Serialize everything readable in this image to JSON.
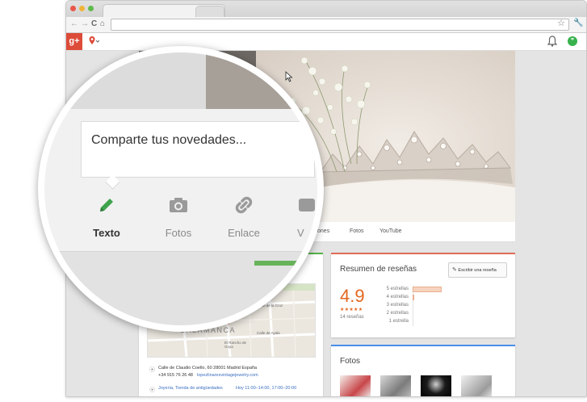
{
  "browser": {
    "buttons": {
      "back": "←",
      "forward": "→",
      "reload": "C",
      "home": "⌂"
    },
    "star_icon": "star-icon",
    "menu_icon": "wrench-icon",
    "colors": {
      "close": "#e9574b",
      "minimize": "#f0b43b",
      "maximize": "#5fba4a"
    }
  },
  "app_bar": {
    "logo": "g+",
    "location_icon": "map-pin-icon",
    "notifications_icon": "bell-icon",
    "hangouts_icon": "hangouts-icon",
    "colors": {
      "brand": "#dd4b39"
    }
  },
  "page_nav": {
    "tabs": [
      "Publicaciones",
      "Fotos",
      "YouTube"
    ]
  },
  "reviews": {
    "title": "Resumen de reseñas",
    "write_button": "Escribir una reseña",
    "score": "4.9",
    "stars": "★★★★★",
    "count": "14 reseñas",
    "bars": [
      {
        "label": "5 estrellas",
        "fraction": 1.0
      },
      {
        "label": "4 estrellas",
        "fraction": 0.05
      },
      {
        "label": "3 estrellas",
        "fraction": 0
      },
      {
        "label": "2 estrellas",
        "fraction": 0
      },
      {
        "label": "1 estrella",
        "fraction": 0
      }
    ],
    "colors": {
      "accent": "#e2671f",
      "border": "#e06c58"
    }
  },
  "photos": {
    "title": "Fotos",
    "colors": {
      "border": "#4a8ee8"
    }
  },
  "info_card": {
    "map_labels": {
      "district": "SALAMANCA",
      "street1": "Calle Don Ramón de la Cruz",
      "street2": "Calle de Ayala",
      "street3": "El Rancho de Goya"
    },
    "address": "Calle de Claudio Coello, 60 28001 Madrid España",
    "phone": "+34 915 76 26 48",
    "website": "lopezlinaresvintagejewelry.com",
    "category": "Joyería, Tienda de antigüedades",
    "hours": "Hoy 11:00–14:00, 17:00–20:00",
    "colors": {
      "border": "#55b24a"
    }
  },
  "magnifier": {
    "share_prompt": "Comparte tus novedades...",
    "actions": [
      {
        "label": "Texto",
        "icon": "pencil-icon",
        "active": true
      },
      {
        "label": "Fotos",
        "icon": "camera-icon",
        "active": false
      },
      {
        "label": "Enlace",
        "icon": "link-icon",
        "active": false
      },
      {
        "label": "V",
        "icon": "video-icon",
        "active": false
      }
    ],
    "colors": {
      "pencil": "#3fa34d"
    }
  }
}
